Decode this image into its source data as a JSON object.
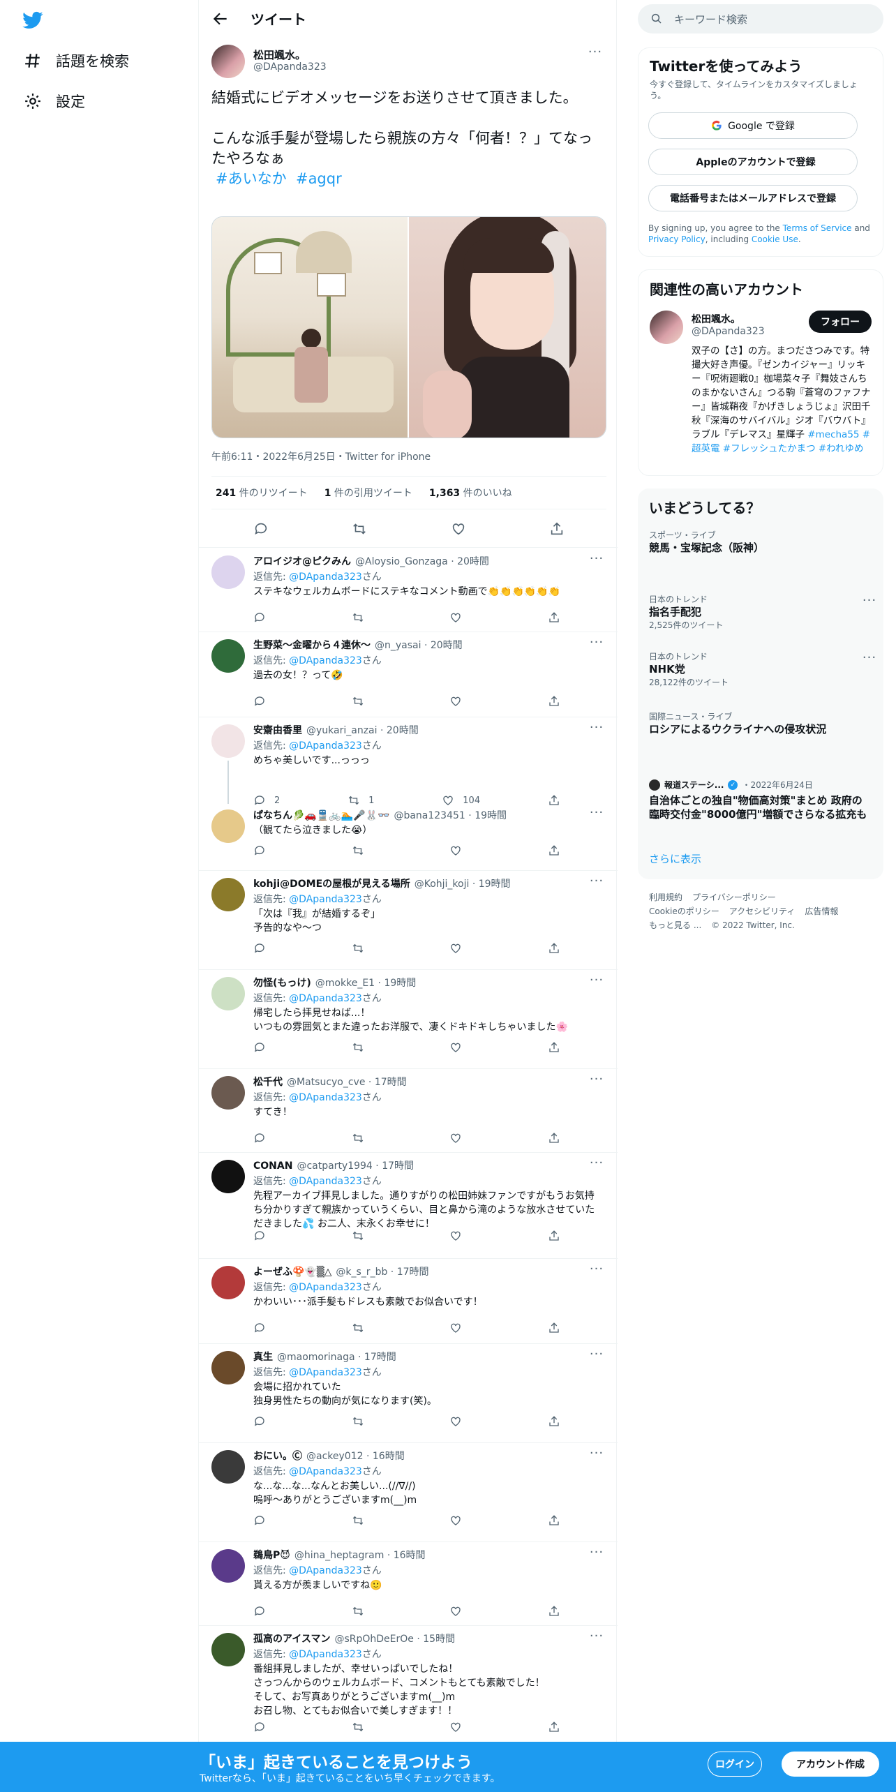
{
  "nav": {
    "explore": "話題を検索",
    "settings": "設定"
  },
  "header": {
    "title": "ツイート"
  },
  "tweet": {
    "name": "松田颯水。",
    "handle": "@DApanda323",
    "text": "結婚式にビデオメッセージをお送りさせて頂きました。\n\nこんな派手髪が登場したら親族の方々「何者！？」てなったやろなぁ",
    "tags": [
      "#あいなか",
      "#agqr"
    ],
    "time": "午前6:11・2022年6月25日・Twitter for iPhone",
    "retweets": "241",
    "retweets_label": "件のリツイート",
    "quotes": "1",
    "quotes_label": "件の引用ツイート",
    "likes": "1,363",
    "likes_label": "件のいいね"
  },
  "replies": [
    {
      "name": "アロイジオ@ピクみん",
      "handle": "@Aloysio_Gonzaga",
      "time": "20時間",
      "to": "@DApanda323",
      "body": "ステキなウェルカムボードにステキなコメント動画で👏👏👏👏👏👏"
    },
    {
      "name": "生野菜～金曜から４連休～",
      "handle": "@n_yasai",
      "time": "20時間",
      "to": "@DApanda323",
      "body": "過去の女！？って🤣"
    },
    {
      "name": "安齋由香里",
      "handle": "@yukari_anzai",
      "time": "20時間",
      "to": "@DApanda323",
      "body": "めちゃ美しいです...っっっ",
      "reply_count": "2",
      "rt_count": "1",
      "like_count": "104"
    },
    {
      "name": "ぱなちん🥬🚗🚆🚲🏊🎤🐰👓",
      "handle": "@bana123451",
      "time": "19時間",
      "to": "",
      "body": "（観てたら泣きました😭）"
    },
    {
      "name": "kohji@DOMEの屋根が見える場所",
      "handle": "@Kohji_koji",
      "time": "19時間",
      "to": "@DApanda323",
      "body": "「次は『我』が結婚するぞ」\n予告的なや〜つ"
    },
    {
      "name": "勿怪(もっけ)",
      "handle": "@mokke_E1",
      "time": "19時間",
      "to": "@DApanda323",
      "body": "帰宅したら拝見せねば...！\nいつもの雰囲気とまた違ったお洋服で、凄くドキドキしちゃいました🌸"
    },
    {
      "name": "松千代",
      "handle": "@Matsucyo_cve",
      "time": "17時間",
      "to": "@DApanda323",
      "body": "すてき！"
    },
    {
      "name": "CONAN",
      "handle": "@catparty1994",
      "time": "17時間",
      "to": "@DApanda323",
      "body": "先程アーカイブ拝見しました。通りすがりの松田姉妹ファンですがもうお気持ち分かりすぎて親族かっていうくらい、目と鼻から滝のような放水させていただきました💦 お二人、末永くお幸せに！"
    },
    {
      "name": "よーぜふ🍄👻▒△",
      "handle": "@k_s_r_bb",
      "time": "17時間",
      "to": "@DApanda323",
      "body": "かわいい･･･派手髪もドレスも素敵でお似合いです！"
    },
    {
      "name": "真生",
      "handle": "@maomorinaga",
      "time": "17時間",
      "to": "@DApanda323",
      "body": "会場に招かれていた\n独身男性たちの動向が気になります(笑)。"
    },
    {
      "name": "おにい。Ⓒ",
      "handle": "@ackey012",
      "time": "16時間",
      "to": "@DApanda323",
      "body": "な...な...な...なんとお美しい...(//∇//)\n嗚呼〜ありがとうございますm(__)m"
    },
    {
      "name": "鵜鳥P😈",
      "handle": "@hina_heptagram",
      "time": "16時間",
      "to": "@DApanda323",
      "body": "貰える方が羨ましいですね🙂"
    },
    {
      "name": "孤高のアイスマン",
      "handle": "@sRpOhDeErOe",
      "time": "15時間",
      "to": "@DApanda323",
      "body": "番組拝見しましたが、幸せいっぱいでしたね！\nさっつんからのウェルカムボード、コメントもとても素敵でした！\nそして、お写真ありがとうございますm(__)m\nお召し物、とてもお似合いで美しすぎます！！"
    }
  ],
  "reply_labels": {
    "to_prefix": "返信先: ",
    "to_suffix": "さん"
  },
  "right": {
    "search_placeholder": "キーワード検索",
    "signup_title": "Twitterを使ってみよう",
    "signup_sub": "今すぐ登録して、タイムラインをカスタマイズしましょう。",
    "google_btn": "Google で登録",
    "apple_btn": "Appleのアカウントで登録",
    "phone_btn": "電話番号またはメールアドレスで登録",
    "terms_1": "By signing up, you agree to the ",
    "terms_link": "Terms of Service",
    "terms_2": " and ",
    "privacy_link": "Privacy Policy",
    "terms_3": ", including ",
    "cookie_link": "Cookie Use",
    "terms_4": ".",
    "related_title": "関連性の高いアカウント",
    "related_name": "松田颯水。",
    "related_handle": "@DApanda323",
    "follow": "フォロー",
    "related_bio": "双子の【さ】の方。まつださつみです。特撮大好き声優。『ゼンカイジャー』リッキー『呪術廻戦0』枷場菜々子『舞妓さんちのまかないさん』つる駒『蒼穹のファフナー』皆城鞘夜『かげきしょうじょ』沢田千秋『深海のサバイバル』ジオ『バウバト』ラブル『デレマス』星輝子",
    "related_tags": "#mecha55 #超英電 #フレッシュたかまつ #われゆめ",
    "trends_title": "いまどうしてる？",
    "trends": [
      {
        "cat": "スポーツ・ライブ",
        "title": "競馬・宝塚記念（阪神）",
        "count": ""
      },
      {
        "cat": "日本のトレンド",
        "title": "指名手配犯",
        "count": "2,525件のツイート"
      },
      {
        "cat": "日本のトレンド",
        "title": "NHK党",
        "count": "28,122件のツイート"
      },
      {
        "cat": "国際ニュース・ライブ",
        "title": "ロシアによるウクライナへの侵攻状況",
        "count": ""
      }
    ],
    "news_source": "報道ステーシ...",
    "news_date": "・2022年6月24日",
    "news_title": "自治体ごとの独自\"物価高対策\"まとめ 政府の臨時交付金\"8000億円\"増額でさらなる拡充も",
    "show_more": "さらに表示",
    "footer": [
      "利用規約",
      "プライバシーポリシー",
      "Cookieのポリシー",
      "アクセシビリティ",
      "広告情報",
      "もっと見る ...",
      "© 2022 Twitter, Inc."
    ]
  },
  "bottom": {
    "title": "「いま」起きていることを見つけよう",
    "sub": "Twitterなら、「いま」起きていることをいち早くチェックできます。",
    "login": "ログイン",
    "signup": "アカウント作成"
  },
  "colors": {
    "accent": "#1d9bf0",
    "text": "#0f1419",
    "muted": "#536471"
  }
}
